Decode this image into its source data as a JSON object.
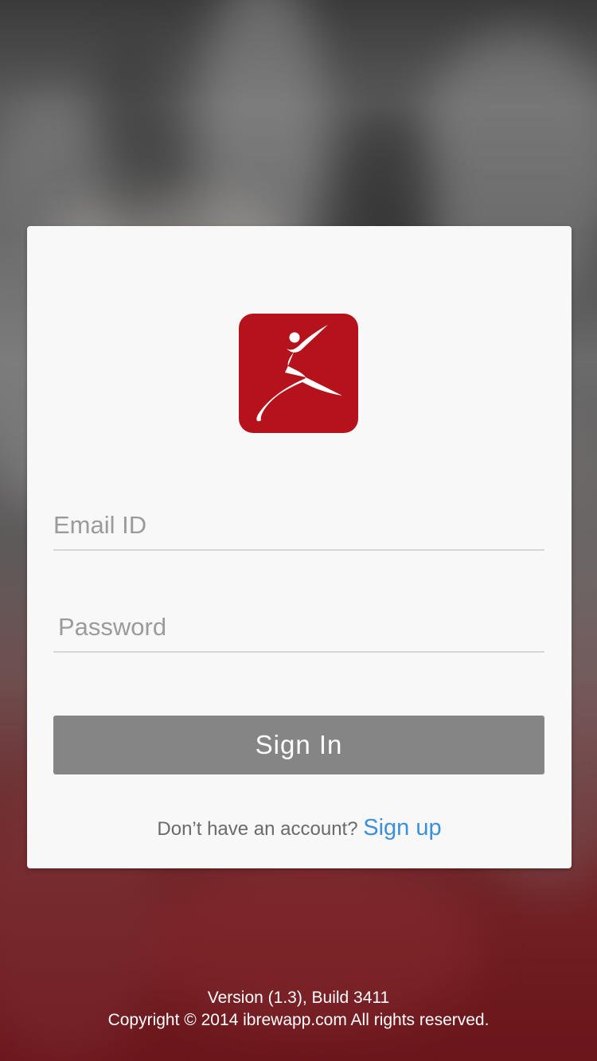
{
  "login": {
    "logo_alt": "app logo",
    "email_placeholder": "Email ID",
    "password_placeholder": "Password",
    "signin_label": "Sign In",
    "signup_prompt": "Don’t have an account?",
    "signup_link": "Sign up"
  },
  "footer": {
    "version": "Version (1.3), Build 3411",
    "copyright": "Copyright © 2014 ibrewapp.com All rights reserved."
  },
  "colors": {
    "brand_red": "#b5121b",
    "link_blue": "#3c8fdc",
    "button_gray": "#858585",
    "card_bg": "#f8f8f8"
  },
  "icons": [
    "app-logo-icon"
  ]
}
